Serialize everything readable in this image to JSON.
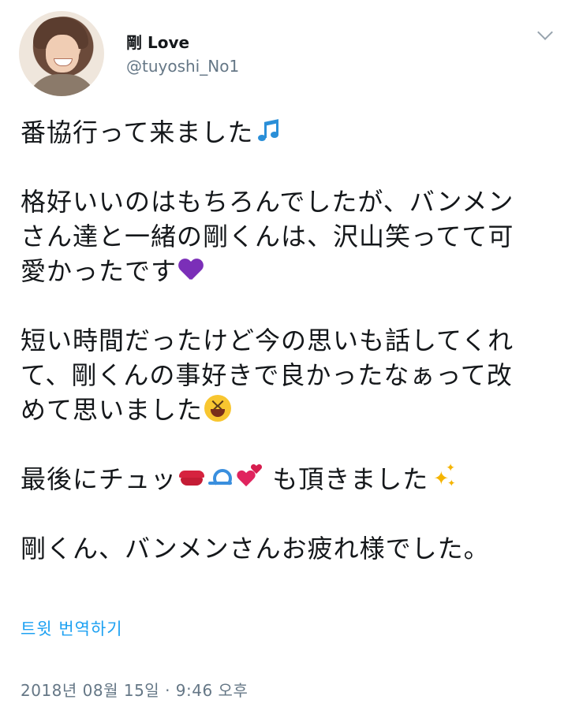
{
  "author": {
    "display_name": "剛 Love",
    "handle": "@tuyoshi_No1"
  },
  "tweet": {
    "lines": [
      "番協行って来ました",
      "格好いいのはもちろんでしたが、バンメン",
      "さん達と一緒の剛くんは、沢山笑ってて可",
      "愛かったです",
      "短い時間だったけど今の思いも話してくれ",
      "て、剛くんの事好きで良かったなぁって改",
      "めて思いました",
      "最後にチュッ",
      " も頂きました",
      "剛くん、バンメンさんお疲れ様でした。"
    ],
    "emoji": {
      "music": "musical-notes",
      "heart": "purple-heart",
      "laugh": "laughing-face",
      "lips": "kiss-lips",
      "loop": "curly-loop",
      "hearts": "two-hearts",
      "sparkles": "sparkles"
    }
  },
  "translate_label": "트윗 번역하기",
  "timestamp": "2018년 08월 15일 · 9:46 오후",
  "colors": {
    "link": "#1da1f2",
    "secondary_text": "#657786",
    "primary_text": "#14171a"
  }
}
